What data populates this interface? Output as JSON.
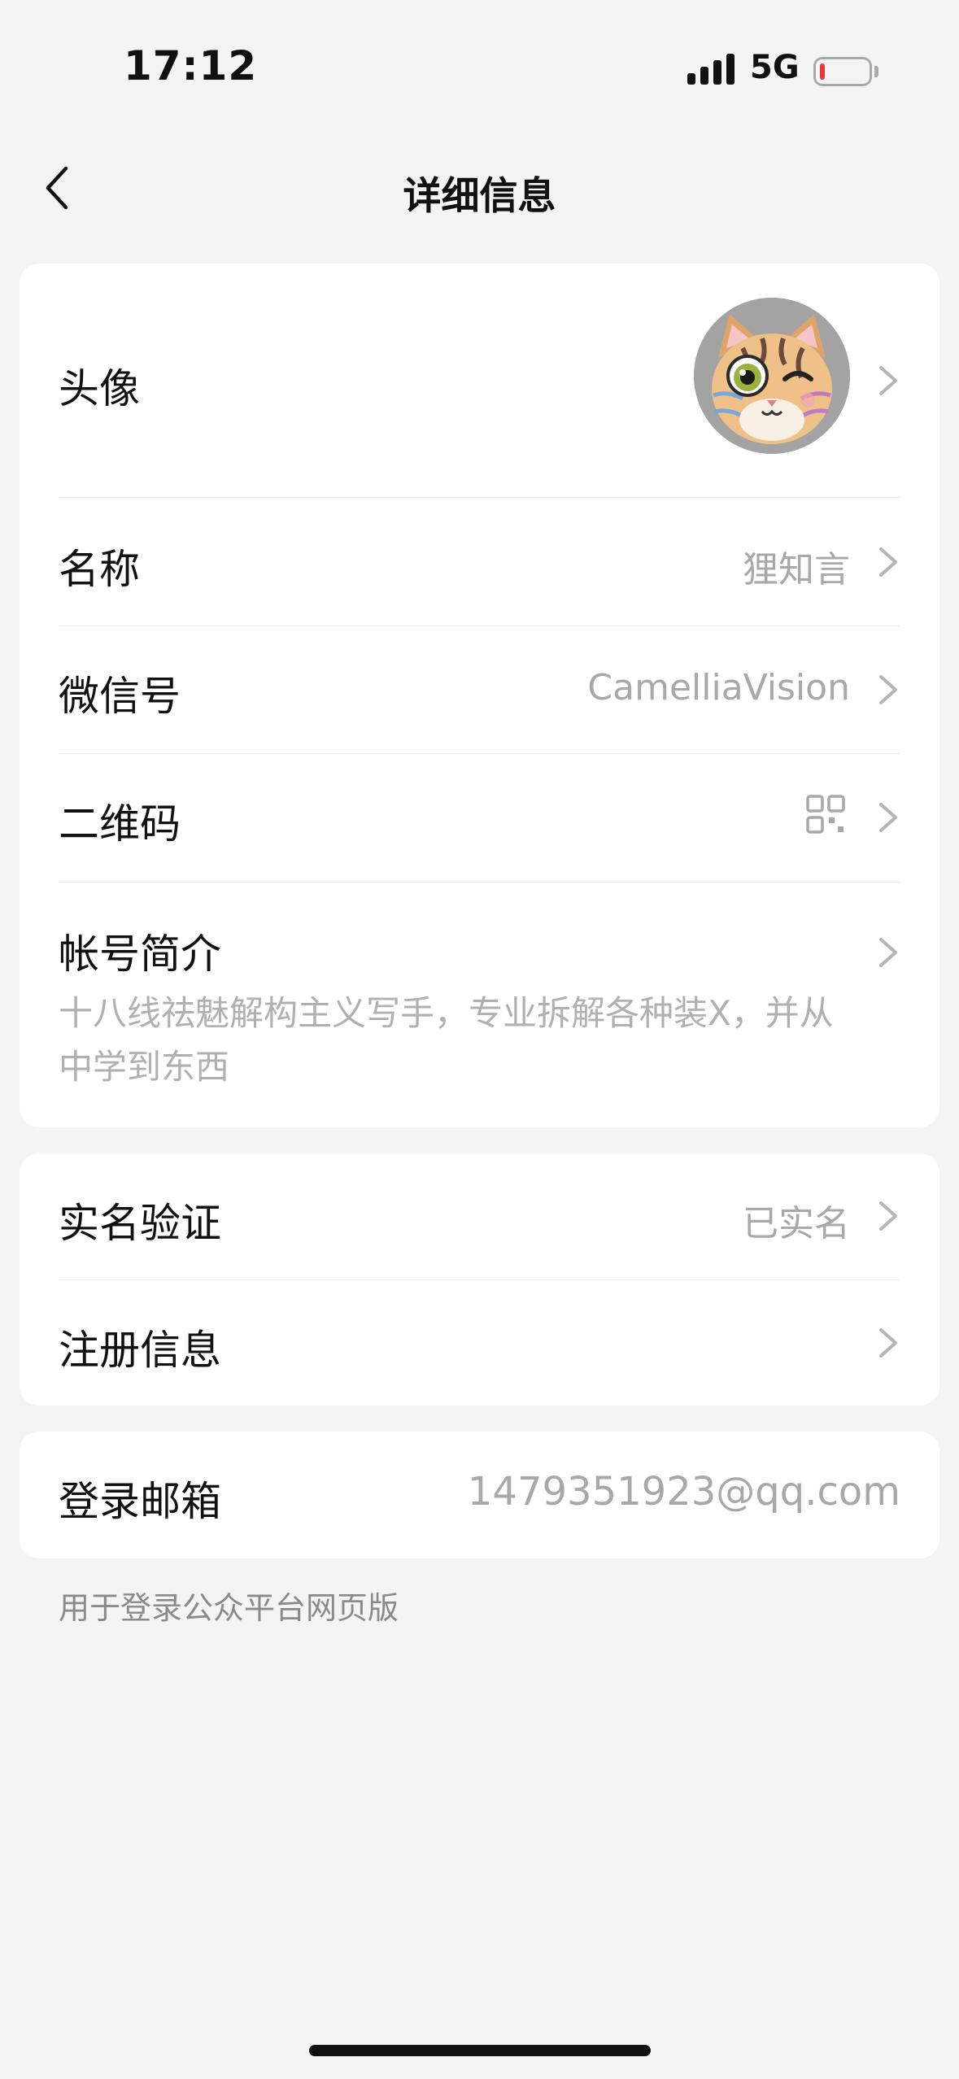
{
  "status_bar": {
    "time": "17:12",
    "network": "5G",
    "battery_level": 0.1,
    "battery_color": "#e53935"
  },
  "nav": {
    "title": "详细信息",
    "back_icon": "chevron-left-icon"
  },
  "profile": {
    "avatar": {
      "label": "头像",
      "image": "winking-cat-illustration"
    },
    "name": {
      "label": "名称",
      "value": "狸知言"
    },
    "wechat_id": {
      "label": "微信号",
      "value": "CamelliaVision"
    },
    "qr_code": {
      "label": "二维码",
      "icon": "qr-code-icon"
    },
    "intro": {
      "label": "帐号简介",
      "text": "十八线祛魅解构主义写手，专业拆解各种装X，并从中学到东西"
    }
  },
  "verification": {
    "real_name": {
      "label": "实名验证",
      "value": "已实名"
    },
    "registration": {
      "label": "注册信息"
    }
  },
  "login": {
    "email": {
      "label": "登录邮箱",
      "value": "1479351923@qq.com"
    },
    "caption": "用于登录公众平台网页版"
  },
  "colors": {
    "background": "#f3f4f3",
    "card": "#ffffff",
    "secondary_text": "#a8a8a8"
  }
}
